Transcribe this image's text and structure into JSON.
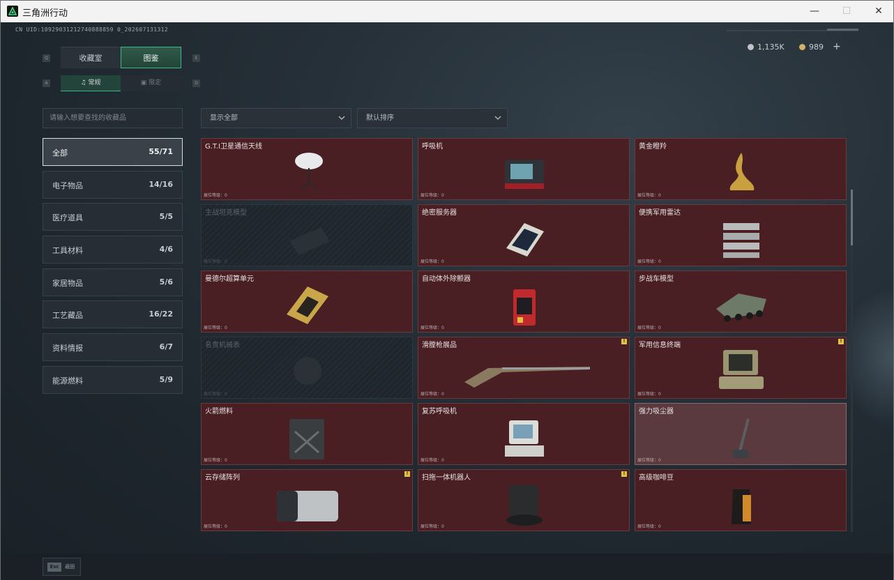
{
  "window": {
    "title": "三角洲行动",
    "controls": {
      "minimize": "—",
      "maximize": "☐",
      "close": "✕"
    }
  },
  "header": {
    "uid": "CN UID:10929031212740888859 0_202607131312",
    "currency": [
      {
        "value": "1,135K",
        "color": "#c0c4c8"
      },
      {
        "value": "989",
        "color": "#d4b06a"
      }
    ],
    "add_label": "+"
  },
  "tabs": {
    "key_left": "Q",
    "key_right": "E",
    "items": [
      {
        "label": "收藏室"
      },
      {
        "label": "图鉴"
      }
    ]
  },
  "subtabs": {
    "key_left": "A",
    "key_right": "D",
    "items": [
      {
        "label": "常规"
      },
      {
        "label": "限定"
      }
    ]
  },
  "filters": {
    "search_placeholder": "请输入想要查找的收藏品",
    "display": "显示全部",
    "sort": "默认排序"
  },
  "categories": [
    {
      "label": "全部",
      "count": "55/71"
    },
    {
      "label": "电子物品",
      "count": "14/16"
    },
    {
      "label": "医疗道具",
      "count": "5/5"
    },
    {
      "label": "工具材料",
      "count": "4/6"
    },
    {
      "label": "家居物品",
      "count": "5/6"
    },
    {
      "label": "工艺藏品",
      "count": "16/22"
    },
    {
      "label": "资料情报",
      "count": "6/7"
    },
    {
      "label": "能源燃料",
      "count": "5/9"
    }
  ],
  "level_label": "展位等级：0",
  "items": [
    {
      "name": "G.T.I卫星通信天线",
      "icon": "satellite-dish-icon",
      "state": "owned"
    },
    {
      "name": "呼吸机",
      "icon": "ventilator-icon",
      "state": "owned"
    },
    {
      "name": "黄金瞪羚",
      "icon": "golden-gazelle-icon",
      "state": "owned"
    },
    {
      "name": "主战坦克模型",
      "icon": "tank-model-icon",
      "state": "locked"
    },
    {
      "name": "绝密服务器",
      "icon": "server-icon",
      "state": "owned"
    },
    {
      "name": "便携军用雷达",
      "icon": "radar-icon",
      "state": "owned"
    },
    {
      "name": "曼德尔超算单元",
      "icon": "supercomputer-unit-icon",
      "state": "owned"
    },
    {
      "name": "自动体外除颤器",
      "icon": "defibrillator-icon",
      "state": "owned"
    },
    {
      "name": "步战车模型",
      "icon": "ifv-model-icon",
      "state": "owned"
    },
    {
      "name": "名贵机械表",
      "icon": "watch-icon",
      "state": "locked"
    },
    {
      "name": "滑膛枪展品",
      "icon": "musket-icon",
      "state": "owned",
      "warn": "!"
    },
    {
      "name": "军用信息终端",
      "icon": "terminal-icon",
      "state": "owned",
      "warn": "!"
    },
    {
      "name": "火箭燃料",
      "icon": "fuel-can-icon",
      "state": "owned"
    },
    {
      "name": "复苏呼吸机",
      "icon": "resuscitator-icon",
      "state": "owned"
    },
    {
      "name": "强力吸尘器",
      "icon": "vacuum-icon",
      "state": "highlight"
    },
    {
      "name": "云存储阵列",
      "icon": "storage-array-icon",
      "state": "owned",
      "warn": "!"
    },
    {
      "name": "扫拖一体机器人",
      "icon": "robot-vacuum-icon",
      "state": "owned",
      "warn": "!"
    },
    {
      "name": "高级咖啡豆",
      "icon": "coffee-bag-icon",
      "state": "owned"
    }
  ],
  "footer": {
    "esc_key": "Esc",
    "esc_label": "返回"
  }
}
